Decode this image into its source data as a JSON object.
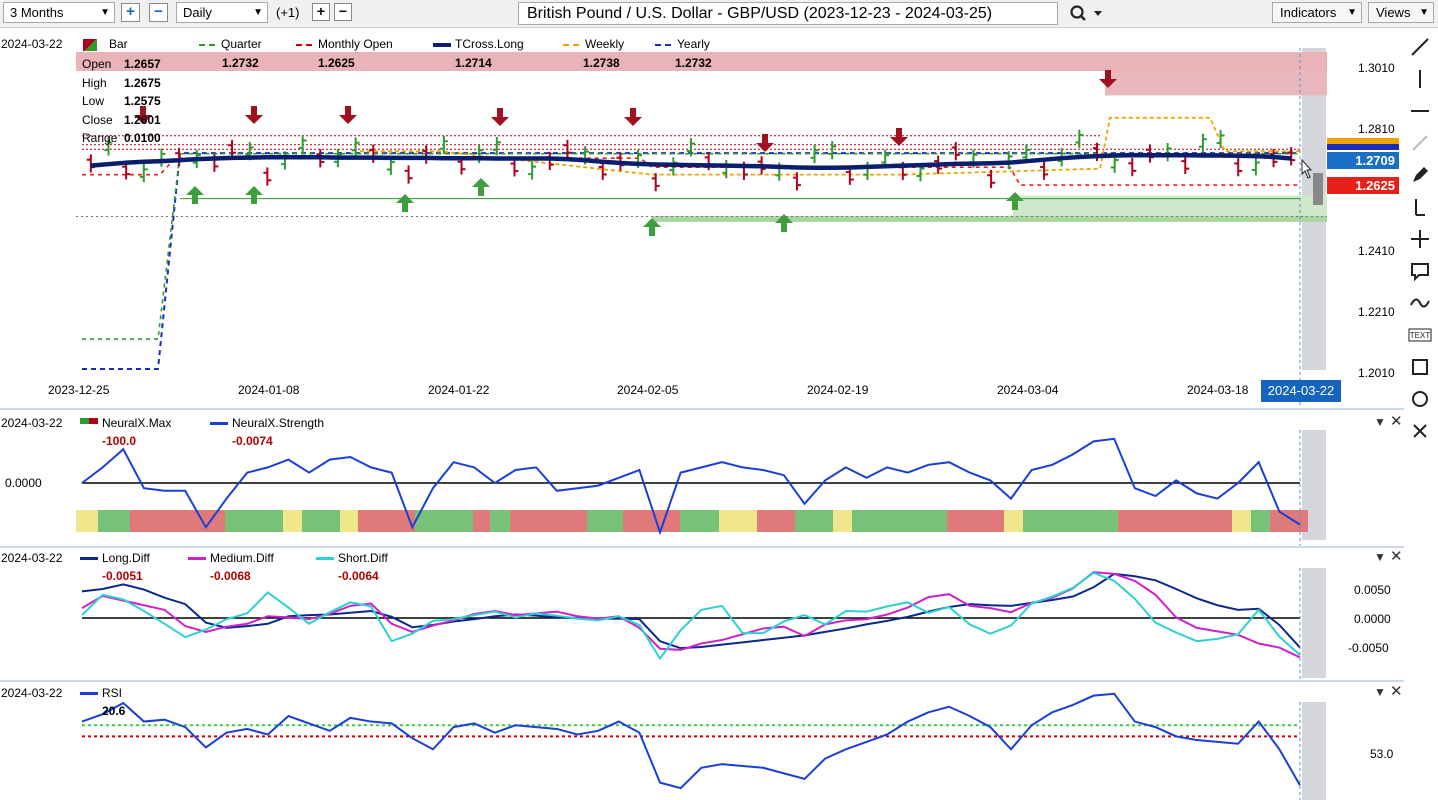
{
  "toolbar": {
    "period": "3 Months",
    "interval": "Daily",
    "offset": "(+1)",
    "title": "British Pound / U.S. Dollar - GBP/USD (2023-12-23 - 2024-03-25)",
    "indicators_label": "Indicators",
    "views_label": "Views"
  },
  "main_pane": {
    "date": "2024-03-22",
    "legend": [
      {
        "name": "Bar",
        "color": "#2e9b2e",
        "style": "square"
      },
      {
        "name": "Quarter",
        "color": "#2e9b2e",
        "style": "dashed"
      },
      {
        "name": "Monthly Open",
        "color": "#d00000",
        "style": "dashed"
      },
      {
        "name": "TCross.Long",
        "color": "#0a1e6e",
        "style": "thick"
      },
      {
        "name": "Weekly",
        "color": "#f2a200",
        "style": "dashed"
      },
      {
        "name": "Yearly",
        "color": "#1a2ebc",
        "style": "dashed"
      }
    ],
    "legend_values": [
      "1.2732",
      "1.2625",
      "1.2714",
      "1.2738",
      "1.2732"
    ],
    "ohlc": [
      {
        "label": "Open",
        "value": "1.2657"
      },
      {
        "label": "High",
        "value": "1.2675"
      },
      {
        "label": "Low",
        "value": "1.2575"
      },
      {
        "label": "Close",
        "value": "1.2601"
      },
      {
        "label": "Range",
        "value": "0.0100"
      }
    ],
    "price_ticks": [
      "1.3010",
      "1.2810",
      "1.2410",
      "1.2210",
      "1.2010"
    ],
    "current_price_label": "1.2709",
    "monthly_open_label": "1.2625",
    "x_ticks": [
      "2023-12-25",
      "2024-01-08",
      "2024-01-22",
      "2024-02-05",
      "2024-02-19",
      "2024-03-04",
      "2024-03-18"
    ],
    "cursor_date": "2024-03-22"
  },
  "neural_pane": {
    "date": "2024-03-22",
    "legend": [
      {
        "name": "NeuralX.Max",
        "value": "-100.0",
        "color": "#2e9b2e"
      },
      {
        "name": "NeuralX.Strength",
        "value": "-0.0074",
        "color": "#1a3fd6"
      }
    ],
    "zero_label": "0.0000"
  },
  "diff_pane": {
    "date": "2024-03-22",
    "legend": [
      {
        "name": "Long.Diff",
        "value": "-0.0051",
        "color": "#0a2a8a"
      },
      {
        "name": "Medium.Diff",
        "value": "-0.0068",
        "color": "#cc22cc"
      },
      {
        "name": "Short.Diff",
        "value": "-0.0064",
        "color": "#2fd0d0"
      }
    ],
    "ticks": [
      "0.0050",
      "0.0000",
      "-0.0050"
    ]
  },
  "rsi_pane": {
    "date": "2024-03-22",
    "legend": [
      {
        "name": "RSI",
        "value": "20.6",
        "color": "#1a3fd6"
      }
    ],
    "tick": "53.0"
  },
  "colors": {
    "accent_blue": "#1565c0",
    "bull": "#2e9b2e",
    "bear": "#b0001a",
    "band_red": "#e07a7a",
    "band_green": "#78c178",
    "band_yellow": "#f0e68c"
  },
  "chart_data": [
    {
      "type": "candlestick",
      "title": "British Pound / U.S. Dollar - GBP/USD (2023-12-23 - 2024-03-25)",
      "ylim": [
        1.2,
        1.303
      ],
      "x_ticks": [
        "2023-12-25",
        "2024-01-08",
        "2024-01-22",
        "2024-02-05",
        "2024-02-19",
        "2024-03-04",
        "2024-03-18"
      ],
      "series": [
        {
          "name": "TCross.Long",
          "values": [
            1.269,
            1.2695,
            1.27,
            1.2703,
            1.2705,
            1.2708,
            1.2712,
            1.2714,
            1.2716,
            1.2717,
            1.2718,
            1.2718,
            1.2718,
            1.2718,
            1.2717,
            1.2717,
            1.2717,
            1.2716,
            1.2716,
            1.2716,
            1.2715,
            1.2715,
            1.2715,
            1.2714,
            1.2714,
            1.2714,
            1.2714,
            1.2712,
            1.2708,
            1.2703,
            1.2699,
            1.2696,
            1.2694,
            1.2693,
            1.2692,
            1.2691,
            1.269,
            1.2689,
            1.2688,
            1.2686,
            1.2684,
            1.2683,
            1.2683,
            1.2684,
            1.2686,
            1.2688,
            1.269,
            1.2692,
            1.2694,
            1.2696,
            1.2697,
            1.2698,
            1.27,
            1.2705,
            1.271,
            1.2715,
            1.2719,
            1.2722,
            1.2724,
            1.2725,
            1.2725,
            1.2725,
            1.2725,
            1.2724,
            1.2724,
            1.2723,
            1.2722,
            1.2719,
            1.2714
          ]
        },
        {
          "name": "Quarter",
          "value": 1.2732
        },
        {
          "name": "Monthly Open",
          "value": 1.2625
        },
        {
          "name": "Weekly",
          "value": 1.2738
        },
        {
          "name": "Yearly",
          "value": 1.2732
        }
      ],
      "last_bar": {
        "open": 1.2657,
        "high": 1.2675,
        "low": 1.2575,
        "close": 1.2601,
        "range": 0.01
      }
    },
    {
      "type": "line",
      "name": "NeuralX.Strength",
      "value": -0.0074,
      "zero": 0.0,
      "values": [
        0.0,
        0.006,
        0.013,
        -0.002,
        -0.003,
        -0.003,
        -0.017,
        -0.006,
        0.004,
        0.006,
        0.009,
        0.004,
        0.009,
        0.01,
        0.006,
        0.004,
        -0.017,
        -0.002,
        0.008,
        0.006,
        0.0,
        0.005,
        0.006,
        -0.003,
        -0.002,
        -0.001,
        0.002,
        0.005,
        -0.019,
        0.004,
        0.006,
        0.008,
        0.006,
        0.005,
        0.003,
        -0.008,
        0.001,
        0.006,
        0.002,
        0.006,
        0.004,
        0.007,
        0.008,
        0.004,
        0.001,
        -0.006,
        0.005,
        0.007,
        0.011,
        0.016,
        0.017,
        -0.002,
        -0.005,
        0.001,
        -0.004,
        -0.006,
        0.0,
        0.008,
        -0.011,
        -0.016
      ]
    },
    {
      "type": "line",
      "x_count": 60,
      "series": [
        {
          "name": "Long.Diff",
          "values": [
            0.0046,
            0.005,
            0.0058,
            0.0049,
            0.0035,
            0.0024,
            -0.0008,
            -0.0017,
            -0.0014,
            -0.001,
            0.0003,
            0.0005,
            0.0006,
            0.0009,
            0.0012,
            0.0002,
            -0.0016,
            -0.0012,
            -0.0006,
            -0.0002,
            0.0003,
            0.0006,
            0.0004,
            0.0001,
            0.0,
            -0.0001,
            -0.0001,
            -0.0002,
            -0.004,
            -0.0052,
            -0.005,
            -0.0046,
            -0.0042,
            -0.0038,
            -0.0034,
            -0.003,
            -0.0024,
            -0.0018,
            -0.0011,
            -0.0005,
            0.0002,
            0.0011,
            0.0019,
            0.0024,
            0.0022,
            0.0021,
            0.0026,
            0.0031,
            0.0037,
            0.0053,
            0.0076,
            0.0072,
            0.0065,
            0.005,
            0.0034,
            0.0022,
            0.0014,
            0.0016,
            -0.0012,
            -0.0051
          ]
        },
        {
          "name": "Medium.Diff",
          "values": [
            0.0017,
            0.0038,
            0.003,
            0.0022,
            0.0014,
            -0.0014,
            -0.0024,
            -0.0015,
            -0.001,
            0.0003,
            0.0001,
            -0.0002,
            0.0007,
            0.0021,
            0.0025,
            -0.001,
            -0.0024,
            -0.0013,
            -0.0004,
            0.0007,
            0.0012,
            0.0005,
            0.0008,
            0.0011,
            0.0003,
            -0.0001,
            0.0003,
            -0.0017,
            -0.0053,
            -0.0055,
            -0.0044,
            -0.0038,
            -0.0028,
            -0.0018,
            -0.0015,
            -0.0031,
            -0.0011,
            -0.0004,
            -0.0002,
            0.0006,
            0.0018,
            0.0036,
            0.0041,
            0.0021,
            0.0017,
            0.001,
            0.0026,
            0.0035,
            0.0051,
            0.0079,
            0.0076,
            0.0064,
            0.004,
            0.0001,
            -0.0017,
            -0.0023,
            -0.0029,
            -0.0044,
            -0.0051,
            -0.0068
          ]
        },
        {
          "name": "Short.Diff",
          "values": [
            0.0005,
            0.004,
            0.0032,
            0.0012,
            -0.001,
            -0.0033,
            -0.002,
            -0.0002,
            0.0008,
            0.0044,
            0.0018,
            -0.001,
            0.001,
            0.0027,
            0.002,
            -0.004,
            -0.0027,
            -0.0005,
            -0.0002,
            0.0005,
            0.0011,
            0.0001,
            0.0008,
            0.0004,
            -0.0001,
            -0.0004,
            0.0003,
            -0.0012,
            -0.007,
            -0.0021,
            0.0014,
            0.0021,
            -0.0026,
            -0.0026,
            -0.0006,
            0.0005,
            -0.0011,
            0.0012,
            0.0011,
            0.002,
            0.0027,
            0.0009,
            0.0019,
            -0.0011,
            -0.0027,
            -0.0013,
            0.0025,
            0.0037,
            0.0052,
            0.0078,
            0.0064,
            0.0033,
            -0.0008,
            -0.0025,
            -0.004,
            -0.0036,
            -0.0028,
            0.0014,
            -0.0032,
            -0.0064
          ]
        }
      ],
      "ticks": [
        0.005,
        0.0,
        -0.005
      ]
    },
    {
      "type": "line",
      "name": "RSI",
      "value": 20.6,
      "values": [
        55,
        59,
        65,
        55,
        56,
        52,
        41,
        49,
        51,
        48,
        58,
        54,
        50,
        57,
        55,
        54,
        46,
        40,
        52,
        54,
        49,
        53,
        52,
        51,
        48,
        50,
        55,
        49,
        22,
        19,
        30,
        32,
        31,
        30,
        27,
        24,
        35,
        40,
        44,
        48,
        55,
        60,
        63,
        58,
        52,
        40,
        53,
        60,
        64,
        69,
        70,
        55,
        52,
        47,
        45,
        44,
        43,
        55,
        40,
        20.6
      ],
      "upper_level": 53.0,
      "lower_level": 47.0,
      "tick": "53.0"
    }
  ]
}
